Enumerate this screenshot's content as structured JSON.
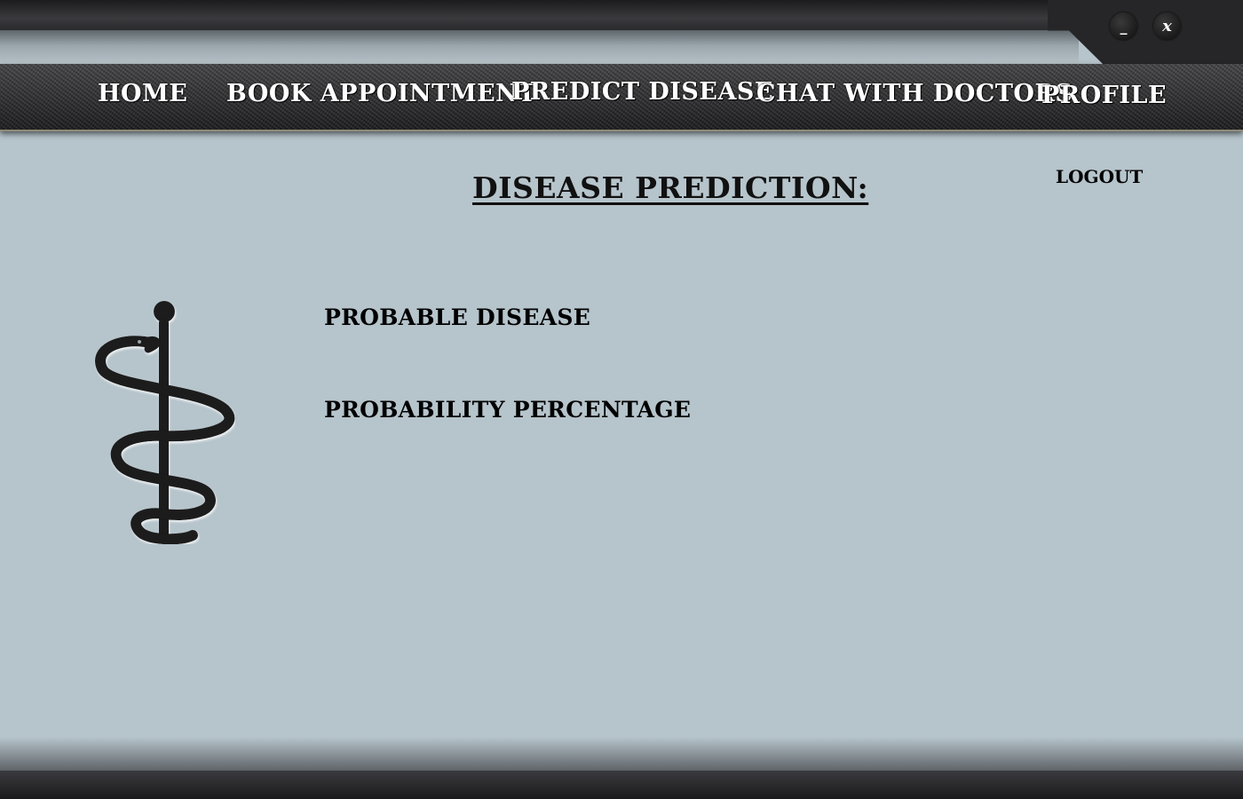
{
  "window": {
    "minimize_label": "_",
    "close_label": "x"
  },
  "nav": {
    "items": [
      {
        "label": "HOME"
      },
      {
        "label": "BOOK APPOINTMENT"
      },
      {
        "label": "PREDICT DISEASE"
      },
      {
        "label": "CHAT WITH DOCTORS"
      },
      {
        "label": "PROFILE"
      }
    ]
  },
  "main": {
    "title": "DISEASE PREDICTION:",
    "logout_label": "LOGOUT",
    "probable_disease_label": "PROBABLE DISEASE",
    "probability_percentage_label": "PROBABILITY PERCENTAGE"
  },
  "icons": {
    "emblem": "rod-of-asclepius-icon"
  },
  "colors": {
    "background": "#b6c4cb",
    "navbar": "#2e2e30",
    "nav_text": "#ffffff",
    "text": "#000000"
  }
}
